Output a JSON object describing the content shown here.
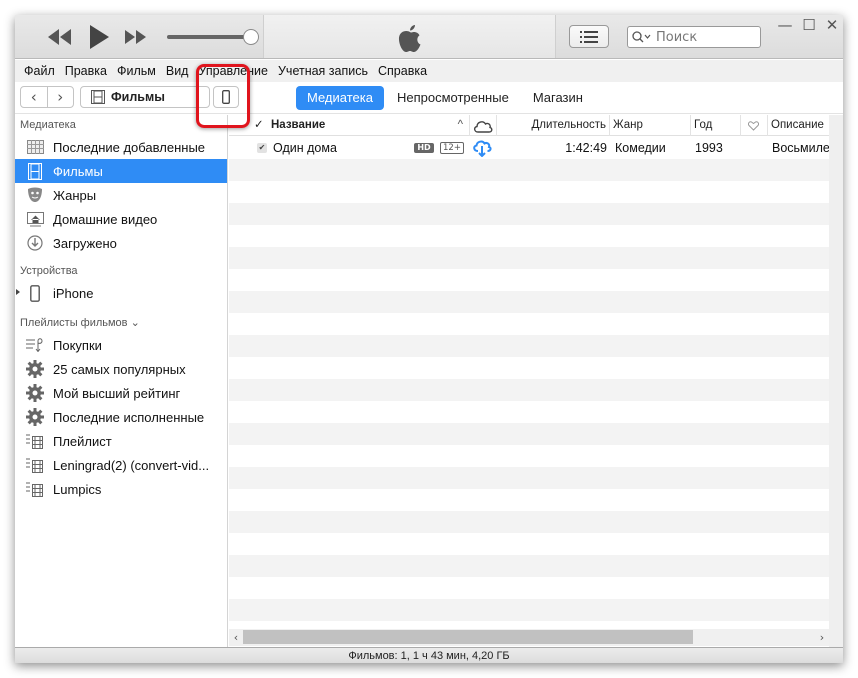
{
  "window": {
    "controls": {
      "minimize": "—",
      "maximize": "☐",
      "close": "✕"
    }
  },
  "player": {
    "volume_level": 1.0,
    "icons": [
      "rewind-icon",
      "play-icon",
      "fast-forward-icon",
      "apple-logo-icon"
    ]
  },
  "search": {
    "placeholder": "Поиск",
    "value": ""
  },
  "menu": [
    "Файл",
    "Правка",
    "Фильм",
    "Вид",
    "Управление",
    "Учетная запись",
    "Справка"
  ],
  "navbar": {
    "back": "‹",
    "forward": "›",
    "media_kind": "Фильмы",
    "tabs": [
      {
        "label": "Медиатека",
        "active": true
      },
      {
        "label": "Непросмотренные",
        "active": false
      },
      {
        "label": "Магазин",
        "active": false
      }
    ]
  },
  "sidebar": {
    "library_title": "Медиатека",
    "library": [
      {
        "label": "Последние добавленные",
        "icon": "grid-icon"
      },
      {
        "label": "Фильмы",
        "icon": "film-icon",
        "selected": true
      },
      {
        "label": "Жанры",
        "icon": "masks-icon"
      },
      {
        "label": "Домашние видео",
        "icon": "home-video-icon"
      },
      {
        "label": "Загружено",
        "icon": "download-icon"
      }
    ],
    "devices_title": "Устройства",
    "devices": [
      {
        "label": "iPhone",
        "icon": "iphone-icon"
      }
    ],
    "playlists_title": "Плейлисты фильмов ⌄",
    "playlists": [
      {
        "label": "Покупки",
        "icon": "purchases-playlist-icon"
      },
      {
        "label": "25 самых популярных",
        "icon": "smart-playlist-gear-icon"
      },
      {
        "label": "Мой высший рейтинг",
        "icon": "smart-playlist-gear-icon"
      },
      {
        "label": "Последние исполненные",
        "icon": "smart-playlist-gear-icon"
      },
      {
        "label": "Плейлист",
        "icon": "film-playlist-icon"
      },
      {
        "label": "Leningrad(2)  (convert-vid...",
        "icon": "film-playlist-icon"
      },
      {
        "label": "Lumpics",
        "icon": "film-playlist-icon"
      }
    ]
  },
  "table": {
    "columns": {
      "check": "✓",
      "name": "Название",
      "sort": "^",
      "duration": "Длительность",
      "genre": "Жанр",
      "year": "Год",
      "description": "Описание"
    },
    "rows": [
      {
        "checked": true,
        "name": "Один дома",
        "hd": "HD",
        "rating": "12+",
        "duration": "1:42:49",
        "genre": "Комедии",
        "year": "1993",
        "description": "Восьмилетний"
      }
    ]
  },
  "scroll": {
    "left": "‹",
    "right": "›"
  },
  "status": "Фильмов: 1, 1 ч 43 мин, 4,20 ГБ"
}
